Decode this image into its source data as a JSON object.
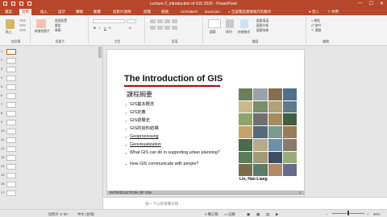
{
  "window": {
    "title": "Lecture 2_introduction of GIS 2020 - PowerPoint",
    "min": "—",
    "max": "☐",
    "close": "✕"
  },
  "tabs": [
    {
      "label": "檔案"
    },
    {
      "label": "常用"
    },
    {
      "label": "插入"
    },
    {
      "label": "設計"
    },
    {
      "label": "轉場"
    },
    {
      "label": "動畫"
    },
    {
      "label": "投影片放映"
    },
    {
      "label": "校閱"
    },
    {
      "label": "檢視"
    },
    {
      "label": "ACROBAT"
    },
    {
      "label": "EverCam"
    }
  ],
  "tell_me": "告訴我您想要執行的動作",
  "account": {
    "signin": "登入",
    "share": "共用"
  },
  "ribbon": {
    "clipboard": {
      "label": "剪貼簿",
      "paste": "貼上"
    },
    "slides": {
      "label": "投影片",
      "new_slide": "新增投影片",
      "layout": "版面配置",
      "reset": "重設",
      "section": "章節"
    },
    "font": {
      "label": "字型"
    },
    "paragraph": {
      "label": "段落"
    },
    "drawing": {
      "label": "繪圖",
      "shapes": "圖案",
      "arrange": "排列",
      "quick_styles": "快速樣式"
    },
    "drawing_fx": {
      "fill": "圖案填滿",
      "outline": "圖案外框",
      "effects": "圖案效果"
    },
    "editing": {
      "label": "編輯",
      "find": "尋找",
      "replace": "取代",
      "select": "選取"
    }
  },
  "thumbnails": [
    "1",
    "2",
    "3",
    "4",
    "5",
    "6",
    "7",
    "8",
    "9",
    "10",
    "11",
    "12",
    "13",
    "14",
    "15",
    "16",
    "17"
  ],
  "slide": {
    "title": "The Introduction of GIS",
    "subtitle": "課程綱要",
    "bullets": [
      "GIS基本概念",
      "GIS定義",
      "GIS發展史",
      "GIS的資料結構",
      "Geoprocessing",
      "Geovisualization",
      "What GIS can do in supporting urban planning?",
      "How GIS communicate with people?"
    ],
    "author": "Lin, Han-Liang",
    "footer": "INTRODUCTION OF GIS",
    "page": "1"
  },
  "notes_placeholder": "按一下以新增備忘稿",
  "status": {
    "slide_count": "投影片 1/ 50",
    "language": "中文 (台灣)",
    "notes": "備忘稿",
    "comments": "註解",
    "zoom": "60%"
  },
  "colors": {
    "accent": "#b7472a",
    "title_rule": "#c00000"
  }
}
